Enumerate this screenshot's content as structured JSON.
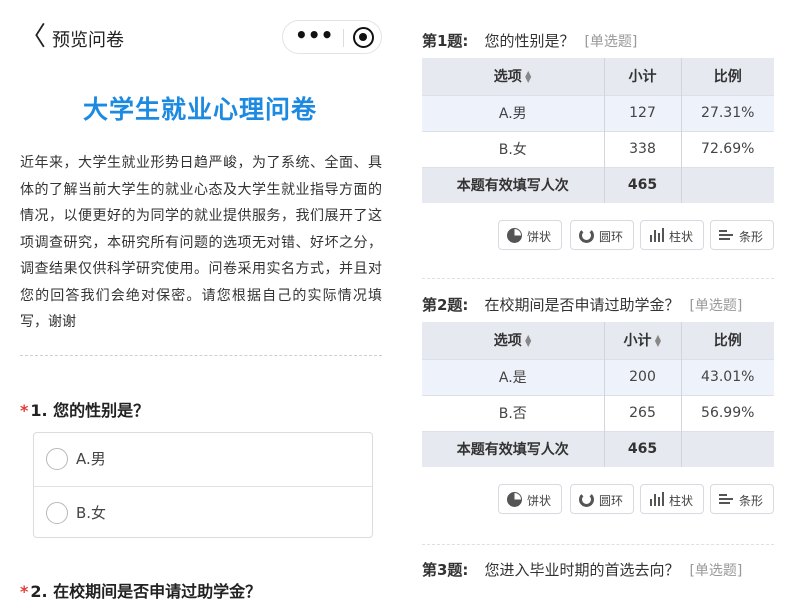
{
  "nav": {
    "title": "预览问卷",
    "back_glyph": "〈",
    "more_glyph": "•••"
  },
  "survey": {
    "title": "大学生就业心理问卷",
    "intro": "近年来，大学生就业形势日趋严峻，为了系统、全面、具体的了解当前大学生的就业心态及大学生就业指导方面的情况，以便更好的为同学的就业提供服务，我们展开了这项调查研究，本研究所有问题的选项无对错、好坏之分，调查结果仅供科学研究使用。问卷采用实名方式，并且对您的回答我们会绝对保密。请您根据自己的实际情况填写，谢谢"
  },
  "form": {
    "q1": {
      "required_mark": "*",
      "title": "1. 您的性别是？",
      "options": [
        "A.男",
        "B.女"
      ]
    },
    "q2": {
      "required_mark": "*",
      "title": "2. 在校期间是否申请过助学金？"
    }
  },
  "results": {
    "headers": {
      "option": "选项",
      "count": "小计",
      "ratio": "比例",
      "sort_glyph": "▲▼"
    },
    "total_label": "本题有效填写人次",
    "buttons": {
      "pie": "饼状",
      "ring": "圆环",
      "bar": "柱状",
      "hbar": "条形"
    },
    "questions": [
      {
        "label": "第1题:",
        "text": "您的性别是？",
        "type": "[单选题]",
        "rows": [
          {
            "option": "A.男",
            "count": "127",
            "ratio": "27.31%"
          },
          {
            "option": "B.女",
            "count": "338",
            "ratio": "72.69%"
          }
        ],
        "total": "465"
      },
      {
        "label": "第2题:",
        "text": "在校期间是否申请过助学金？",
        "type": "[单选题]",
        "rows": [
          {
            "option": "A.是",
            "count": "200",
            "ratio": "43.01%"
          },
          {
            "option": "B.否",
            "count": "265",
            "ratio": "56.99%"
          }
        ],
        "total": "465"
      },
      {
        "label": "第3题:",
        "text": "您进入毕业时期的首选去向？",
        "type": "[单选题]"
      }
    ]
  }
}
